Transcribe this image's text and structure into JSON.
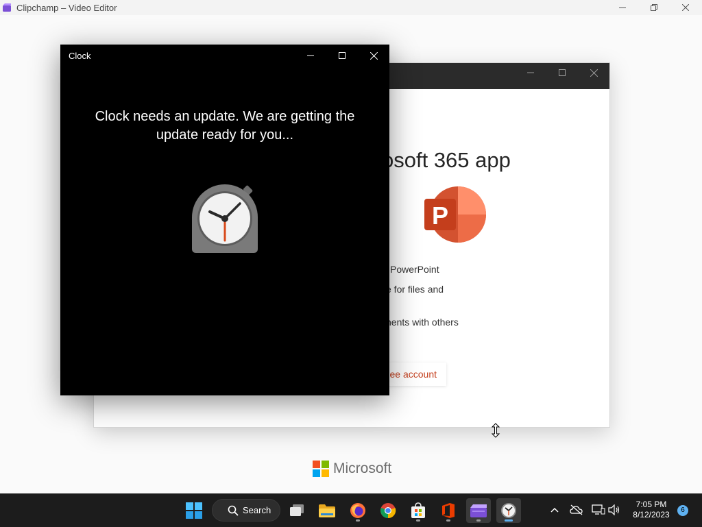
{
  "clipchamp_window": {
    "title": "Clipchamp – Video Editor",
    "icon": "clipchamp-icon"
  },
  "m365_window": {
    "heading": "osoft 365 app",
    "app_logo": "powerpoint-logo",
    "lines": [
      "PowerPoint",
      "e for files and",
      "nents with others"
    ],
    "button_label": "ee account",
    "accent_color": "#c43e1c"
  },
  "clock_window": {
    "title": "Clock",
    "message": "Clock needs an update. We are getting the update ready for you...",
    "app_icon": "clock-app-icon"
  },
  "footer": {
    "brand": "Microsoft"
  },
  "taskbar": {
    "search_label": "Search",
    "pinned_apps": [
      "start",
      "search",
      "task-view",
      "file-explorer",
      "firefox",
      "chrome",
      "microsoft-store",
      "office",
      "clipchamp",
      "clock"
    ],
    "time": "7:05 PM",
    "date": "8/12/2023",
    "notification_count": "6",
    "accent_color": "#5fb2f2"
  }
}
